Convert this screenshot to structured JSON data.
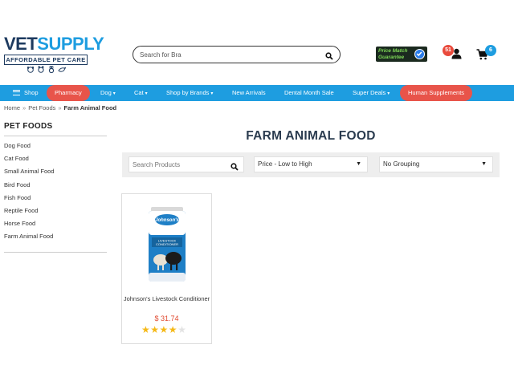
{
  "logo": {
    "part1": "VET",
    "part2": "SUPPLY",
    "tagline": "AFFORDABLE PET CARE"
  },
  "search": {
    "value": "Search for Bra",
    "icon": "search-icon"
  },
  "price_match": {
    "line1": "Price Match",
    "line2": "Guarantee"
  },
  "account": {
    "count": "51",
    "icon": "user-icon"
  },
  "cart": {
    "count": "6",
    "icon": "cart-icon"
  },
  "nav": {
    "items": [
      {
        "label": "Shop"
      },
      {
        "label": "Pharmacy"
      },
      {
        "label": "Dog"
      },
      {
        "label": "Cat"
      },
      {
        "label": "Shop by Brands"
      },
      {
        "label": "New Arrivals"
      },
      {
        "label": "Dental Month Sale"
      },
      {
        "label": "Super Deals"
      },
      {
        "label": "Human Supplements"
      }
    ]
  },
  "breadcrumb": {
    "items": [
      "Home",
      "Pet Foods",
      "Farm Animal Food"
    ]
  },
  "sidebar": {
    "title": "PET FOODS",
    "items": [
      "Dog Food",
      "Cat Food",
      "Small Animal Food",
      "Bird Food",
      "Fish Food",
      "Reptile Food",
      "Horse Food",
      "Farm Animal Food"
    ]
  },
  "main": {
    "title": "FARM ANIMAL FOOD",
    "search_placeholder": "Search Products",
    "sort_value": "Price - Low to High",
    "group_value": "No Grouping"
  },
  "products": [
    {
      "brand": "Johnson's",
      "pack_text": "LIVESTOCK CONDITIONER",
      "name": "Johnson's Livestock Conditioner",
      "price": "$ 31.74",
      "rating": 4,
      "rating_max": 5
    }
  ],
  "colors": {
    "brand_blue": "#1e9de0",
    "brand_navy": "#1d3a5f",
    "accent_red": "#e8544a",
    "price_red": "#e0492f",
    "star_yellow": "#f5b918"
  }
}
